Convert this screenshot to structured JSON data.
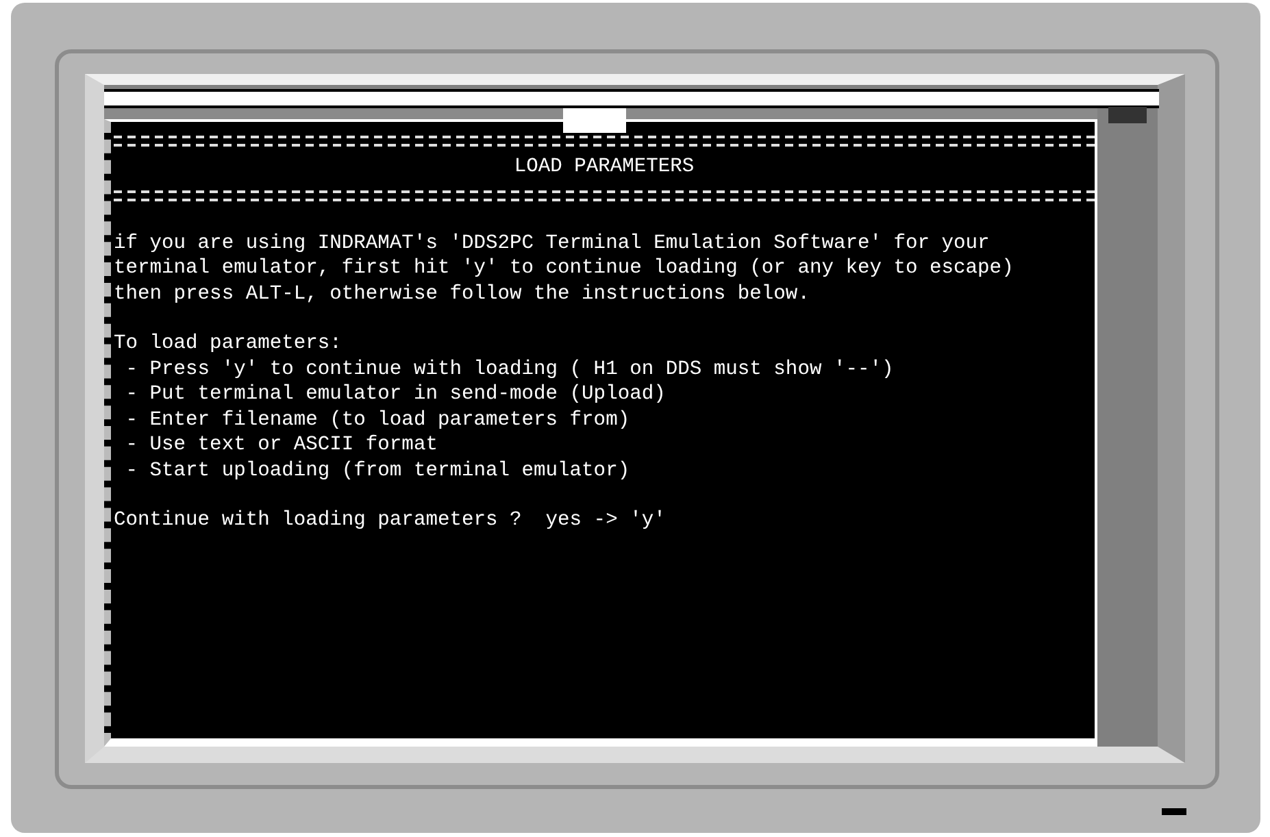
{
  "terminal": {
    "title": "LOAD PARAMETERS",
    "intro": [
      "if you are using INDRAMAT's 'DDS2PC Terminal Emulation Software' for your",
      "terminal emulator, first hit 'y' to continue loading (or any key to escape)",
      "then press ALT-L, otherwise follow the instructions below."
    ],
    "instructions": {
      "heading": "To load parameters:",
      "steps": [
        " - Press 'y' to continue with loading ( H1 on DDS must show '--')",
        " - Put terminal emulator in send-mode (Upload)",
        " - Enter filename (to load parameters from)",
        " - Use text or ASCII format",
        " - Start uploading (from terminal emulator)"
      ]
    },
    "prompt": "Continue with loading parameters ?  yes -> 'y'"
  }
}
